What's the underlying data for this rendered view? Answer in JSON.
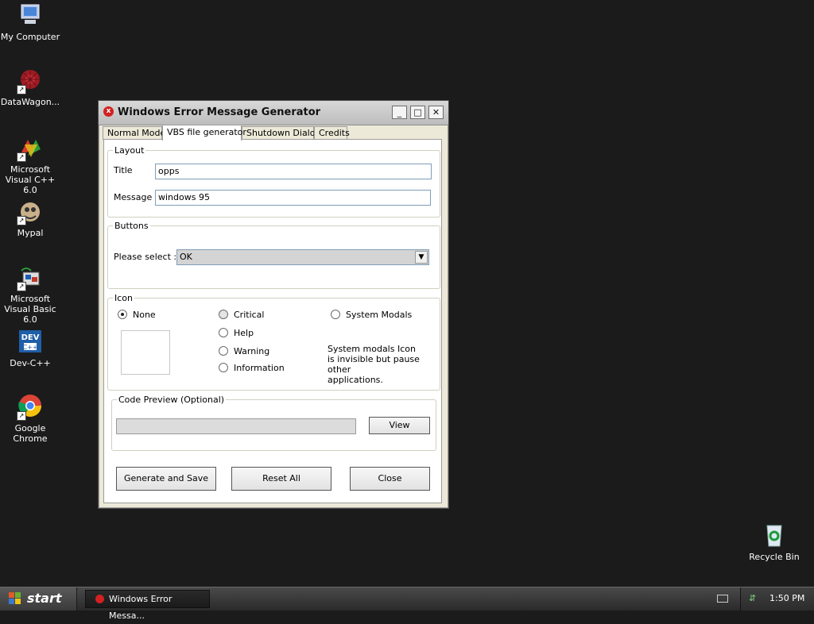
{
  "desktop": {
    "icons": [
      {
        "label": "My Computer",
        "icon": "my-computer-icon"
      },
      {
        "label": "DataWagon...",
        "icon": "datawagon-icon"
      },
      {
        "label": "Microsoft Visual C++ 6.0",
        "icon": "visual-cpp-icon"
      },
      {
        "label": "Mypal",
        "icon": "mypal-icon"
      },
      {
        "label": "Microsoft Visual Basic 6.0",
        "icon": "visual-basic-icon"
      },
      {
        "label": "Dev-C++",
        "icon": "devcpp-icon"
      },
      {
        "label": "Google Chrome",
        "icon": "chrome-icon"
      },
      {
        "label": "Recycle Bin",
        "icon": "recycle-bin-icon"
      }
    ]
  },
  "window": {
    "title": "Windows Error Message Generator",
    "tabs": [
      {
        "label": "Normal Mode"
      },
      {
        "label": "VBS file generator",
        "active": true
      },
      {
        "label": "Shutdown Dialog"
      },
      {
        "label": "Credits"
      }
    ],
    "layout": {
      "legend": "Layout",
      "title_label": "Title",
      "title_value": "opps",
      "message_label": "Message",
      "message_value": "windows 95"
    },
    "buttons_group": {
      "legend": "Buttons",
      "select_label": "Please select :",
      "selected": "OK"
    },
    "icon_group": {
      "legend": "Icon",
      "options": {
        "none": "None",
        "critical": "Critical",
        "help": "Help",
        "warning": "Warning",
        "information": "Information",
        "system_modals": "System Modals"
      },
      "selected": "None",
      "note_line1": "System modals Icon",
      "note_line2": "is invisible but pause other",
      "note_line3": "applications."
    },
    "code_preview": {
      "legend": "Code Preview (Optional)",
      "view_label": "View"
    },
    "actions": {
      "generate": "Generate and Save",
      "reset": "Reset All",
      "close": "Close"
    }
  },
  "taskbar": {
    "start_label": "start",
    "task_label": "Windows Error Messa...",
    "clock": "1:50 PM"
  },
  "colors": {
    "desktop_bg": "#1b1b1b",
    "error_icon": "#d32020"
  }
}
